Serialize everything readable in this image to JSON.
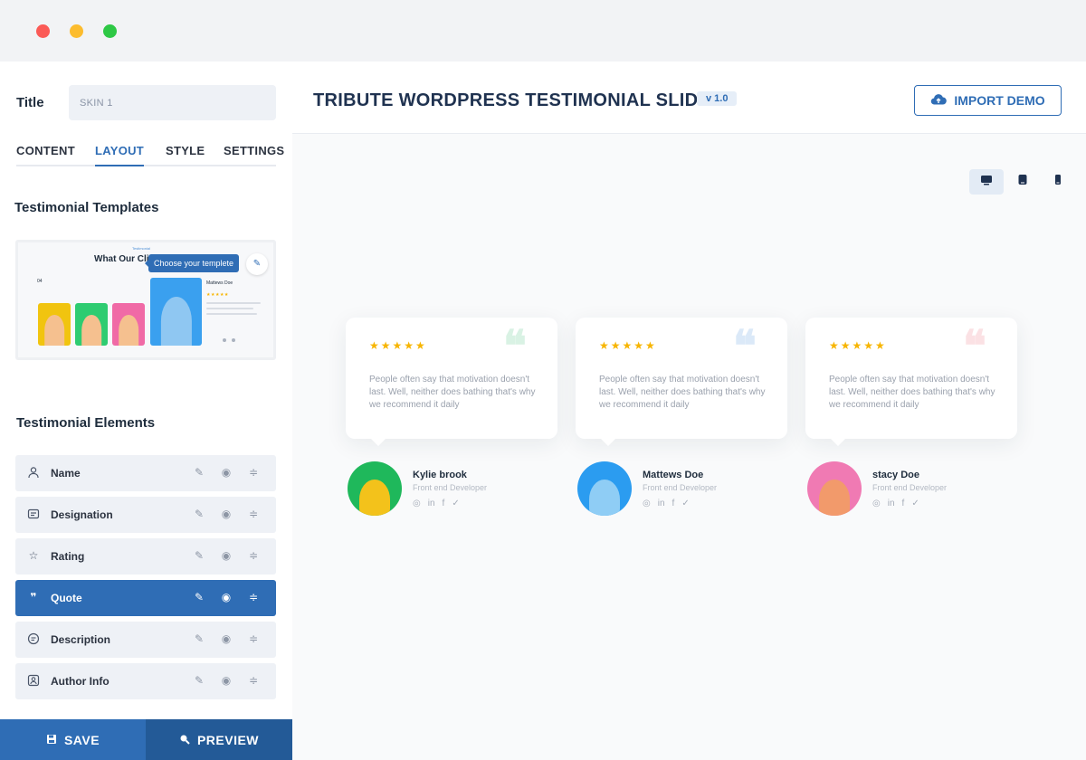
{
  "window": {
    "controls": [
      "close",
      "minimize",
      "maximize"
    ]
  },
  "sidebar": {
    "title_label": "Title",
    "title_value": "SKIN 1",
    "tabs": [
      {
        "label": "CONTENT",
        "active": false
      },
      {
        "label": "LAYOUT",
        "active": true
      },
      {
        "label": "STYLE",
        "active": false
      },
      {
        "label": "SETTINGS",
        "active": false
      }
    ],
    "templates_heading": "Testimonial Templates",
    "template_preview": {
      "small_label": "Testimonial",
      "heading": "What Our Cli",
      "tooltip": "Choose your templete",
      "counter": "04",
      "name": "Mattews Doe",
      "stars": "★★★★★"
    },
    "elements_heading": "Testimonial Elements",
    "elements": [
      {
        "label": "Name",
        "icon": "user-icon",
        "active": false
      },
      {
        "label": "Designation",
        "icon": "id-card-icon",
        "active": false
      },
      {
        "label": "Rating",
        "icon": "star-icon",
        "active": false
      },
      {
        "label": "Quote",
        "icon": "quote-icon",
        "active": true
      },
      {
        "label": "Description",
        "icon": "description-icon",
        "active": false
      },
      {
        "label": "Author Info",
        "icon": "author-icon",
        "active": false
      }
    ],
    "save_label": "SAVE",
    "preview_label": "PREVIEW"
  },
  "header": {
    "title": "TRIBUTE WORDPRESS TESTIMONIAL SLIDER",
    "version": "v 1.0",
    "import_label": "IMPORT DEMO"
  },
  "devices": [
    "desktop-icon",
    "tablet-icon",
    "mobile-icon"
  ],
  "colors": {
    "accent": "#2f6db5",
    "star": "#f7b500",
    "quote_green": "#d9f2e4",
    "quote_blue": "#dbe9f8",
    "quote_pink": "#fbe1e4"
  },
  "testimonials": [
    {
      "stars": "★★★★★",
      "text": "People often say that motivation doesn't last. Well, neither does bathing that's why we recommend it daily",
      "name": "Kylie brook",
      "role": "Front end Developer",
      "avatar_bg": "#1fb85b",
      "quote_color": "#d9f2e4"
    },
    {
      "stars": "★★★★★",
      "text": "People often say that motivation doesn't last. Well, neither does bathing that's why we recommend it daily",
      "name": "Mattews Doe",
      "role": "Front end Developer",
      "avatar_bg": "#2b9cf0",
      "quote_color": "#dbe9f8"
    },
    {
      "stars": "★★★★★",
      "text": "People often say that motivation doesn't last. Well, neither does bathing that's why we recommend it daily",
      "name": "stacy Doe",
      "role": "Front end Developer",
      "avatar_bg": "#f07ab3",
      "quote_color": "#fbe1e4"
    }
  ]
}
